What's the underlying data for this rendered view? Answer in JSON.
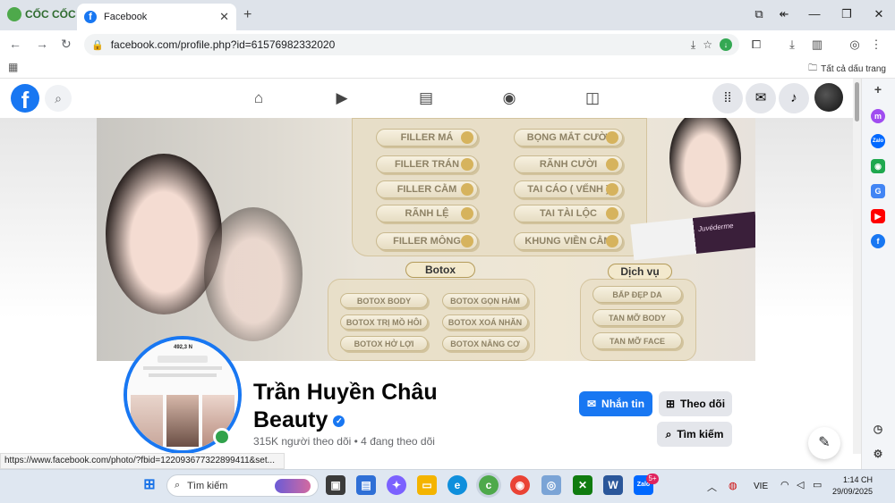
{
  "browser": {
    "brand": "CỐC CỐC",
    "tab_title": "Facebook",
    "url": "facebook.com/profile.php?id=61576982332020",
    "bookmarks_label": "Tất cả dấu trang"
  },
  "cover": {
    "filler_left": [
      "FILLER MÁ",
      "FILLER TRÁN",
      "FILLER CẰM",
      "RÃNH LỆ",
      "FILLER MÔNG"
    ],
    "filler_right": [
      "BỌNG MẮT CƯỜI",
      "RÃNH CƯỜI",
      "TAI CÁO ( VỂNH )",
      "TAI TÀI LỘC",
      "KHUNG VIỀN CẰM"
    ],
    "section_botox": "Botox",
    "section_dichvu": "Dịch vụ",
    "botox_left": [
      "BOTOX BODY",
      "BOTOX TRỊ MỒ HÔI",
      "BOTOX HỞ LỢI"
    ],
    "botox_right": [
      "BOTOX GỌN HÀM",
      "BOTOX XOÁ NHĂN",
      "BOTOX NÂNG CƠ"
    ],
    "dichvu": [
      "BẤP ĐẸP DA",
      "TAN MỠ BODY",
      "TAN MỠ FACE"
    ],
    "product_label": "Juvéderme"
  },
  "profile": {
    "name": "Trần Huyền Châu Beauty",
    "stats": "315K người theo dõi • 4 đang theo dõi",
    "message_label": "Nhắn tin",
    "follow_label": "Theo dõi",
    "search_label": "Tìm kiếm",
    "avatar_count": "492,3 N"
  },
  "status_url": "https://www.facebook.com/photo/?fbid=122093677322899411&set...",
  "taskbar": {
    "search_placeholder": "Tìm kiếm",
    "lang": "VIE",
    "time": "1:14 CH",
    "date": "29/09/2025",
    "zalo_badge": "5+"
  },
  "colors": {
    "facebook_blue": "#1877f2",
    "online_green": "#31a24c"
  }
}
